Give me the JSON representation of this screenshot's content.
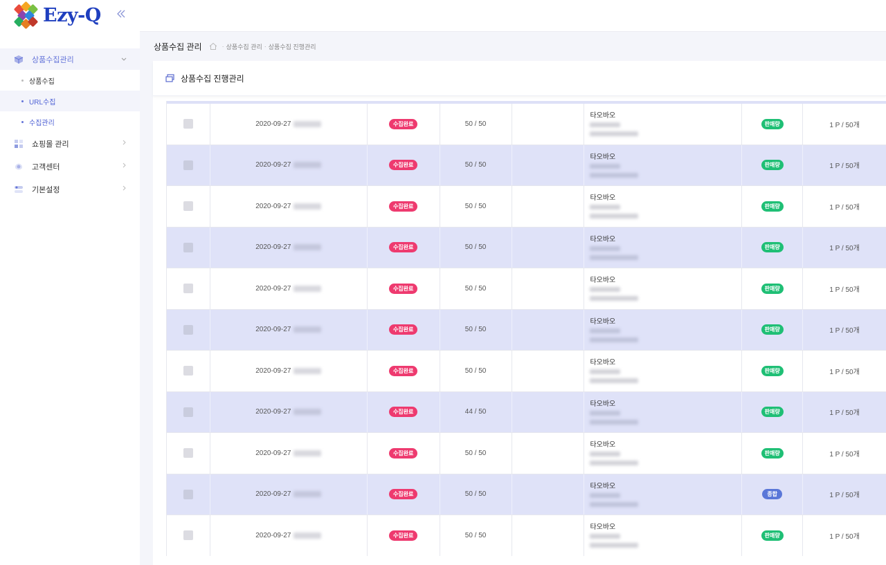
{
  "app": {
    "logo_text": "Ezy-Q"
  },
  "sidebar": {
    "menu": [
      {
        "label": "상품수집관리",
        "icon": "box-icon",
        "open": true,
        "children": [
          {
            "label": "상품수집"
          },
          {
            "label": "URL수집"
          },
          {
            "label": "수집관리"
          }
        ]
      },
      {
        "label": "쇼핑몰 관리",
        "icon": "store-icon",
        "open": false
      },
      {
        "label": "고객센터",
        "icon": "headset-icon",
        "open": false
      },
      {
        "label": "기본설정",
        "icon": "settings-icon",
        "open": false
      }
    ]
  },
  "breadcrumb": {
    "title": "상품수집 관리",
    "items": [
      "상품수집 관리",
      "상품수집 진행관리"
    ]
  },
  "card": {
    "title": "상품수집 진행관리"
  },
  "table": {
    "rows": [
      {
        "date": "2020-09-27",
        "status": "수집완료",
        "count": "50 / 50",
        "source": "타오바오",
        "type": "판매량",
        "type_color": "green",
        "pages": "1 P / 50개"
      },
      {
        "date": "2020-09-27",
        "status": "수집완료",
        "count": "50 / 50",
        "source": "타오바오",
        "type": "판매량",
        "type_color": "green",
        "pages": "1 P / 50개"
      },
      {
        "date": "2020-09-27",
        "status": "수집완료",
        "count": "50 / 50",
        "source": "타오바오",
        "type": "판매량",
        "type_color": "green",
        "pages": "1 P / 50개"
      },
      {
        "date": "2020-09-27",
        "status": "수집완료",
        "count": "50 / 50",
        "source": "타오바오",
        "type": "판매량",
        "type_color": "green",
        "pages": "1 P / 50개"
      },
      {
        "date": "2020-09-27",
        "status": "수집완료",
        "count": "50 / 50",
        "source": "타오바오",
        "type": "판매량",
        "type_color": "green",
        "pages": "1 P / 50개"
      },
      {
        "date": "2020-09-27",
        "status": "수집완료",
        "count": "50 / 50",
        "source": "타오바오",
        "type": "판매량",
        "type_color": "green",
        "pages": "1 P / 50개"
      },
      {
        "date": "2020-09-27",
        "status": "수집완료",
        "count": "50 / 50",
        "source": "타오바오",
        "type": "판매량",
        "type_color": "green",
        "pages": "1 P / 50개"
      },
      {
        "date": "2020-09-27",
        "status": "수집완료",
        "count": "44 / 50",
        "source": "타오바오",
        "type": "판매량",
        "type_color": "green",
        "pages": "1 P / 50개"
      },
      {
        "date": "2020-09-27",
        "status": "수집완료",
        "count": "50 / 50",
        "source": "타오바오",
        "type": "판매량",
        "type_color": "green",
        "pages": "1 P / 50개"
      },
      {
        "date": "2020-09-27",
        "status": "수집완료",
        "count": "50 / 50",
        "source": "타오바오",
        "type": "종합",
        "type_color": "blue",
        "pages": "1 P / 50개"
      },
      {
        "date": "2020-09-27",
        "status": "수집완료",
        "count": "50 / 50",
        "source": "타오바오",
        "type": "판매량",
        "type_color": "green",
        "pages": "1 P / 50개"
      }
    ]
  }
}
